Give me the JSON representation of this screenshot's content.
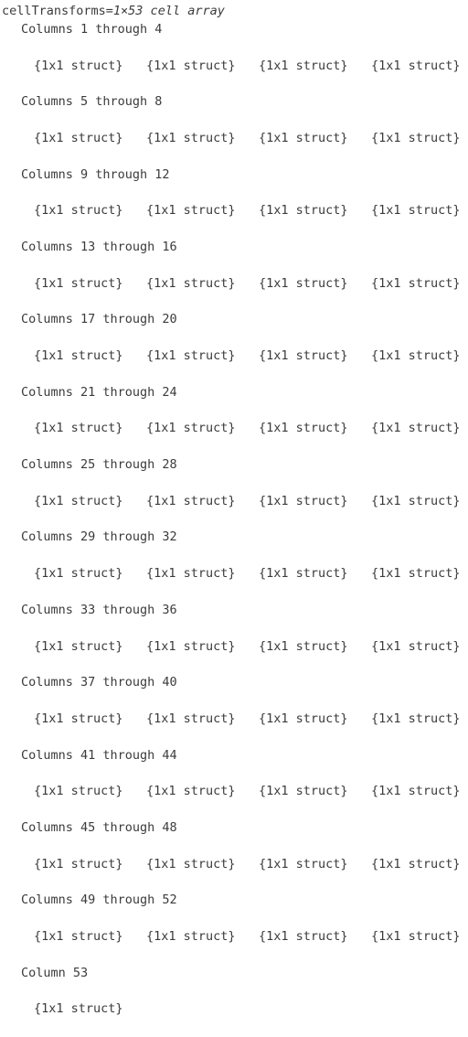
{
  "console": {
    "variable_header": {
      "name": "cellTransforms=",
      "description": "1×53 cell array"
    },
    "cell_value_label": "{1x1 struct}",
    "blocks": [
      {
        "heading": "Columns 1 through 4",
        "count": 4
      },
      {
        "heading": "Columns 5 through 8",
        "count": 4
      },
      {
        "heading": "Columns 9 through 12",
        "count": 4
      },
      {
        "heading": "Columns 13 through 16",
        "count": 4
      },
      {
        "heading": "Columns 17 through 20",
        "count": 4
      },
      {
        "heading": "Columns 21 through 24",
        "count": 4
      },
      {
        "heading": "Columns 25 through 28",
        "count": 4
      },
      {
        "heading": "Columns 29 through 32",
        "count": 4
      },
      {
        "heading": "Columns 33 through 36",
        "count": 4
      },
      {
        "heading": "Columns 37 through 40",
        "count": 4
      },
      {
        "heading": "Columns 41 through 44",
        "count": 4
      },
      {
        "heading": "Columns 45 through 48",
        "count": 4
      },
      {
        "heading": "Columns 49 through 52",
        "count": 4
      },
      {
        "heading": "Column 53",
        "count": 1
      }
    ]
  },
  "theme": {
    "background": "#ffffff",
    "text": "#3b3b3b"
  }
}
